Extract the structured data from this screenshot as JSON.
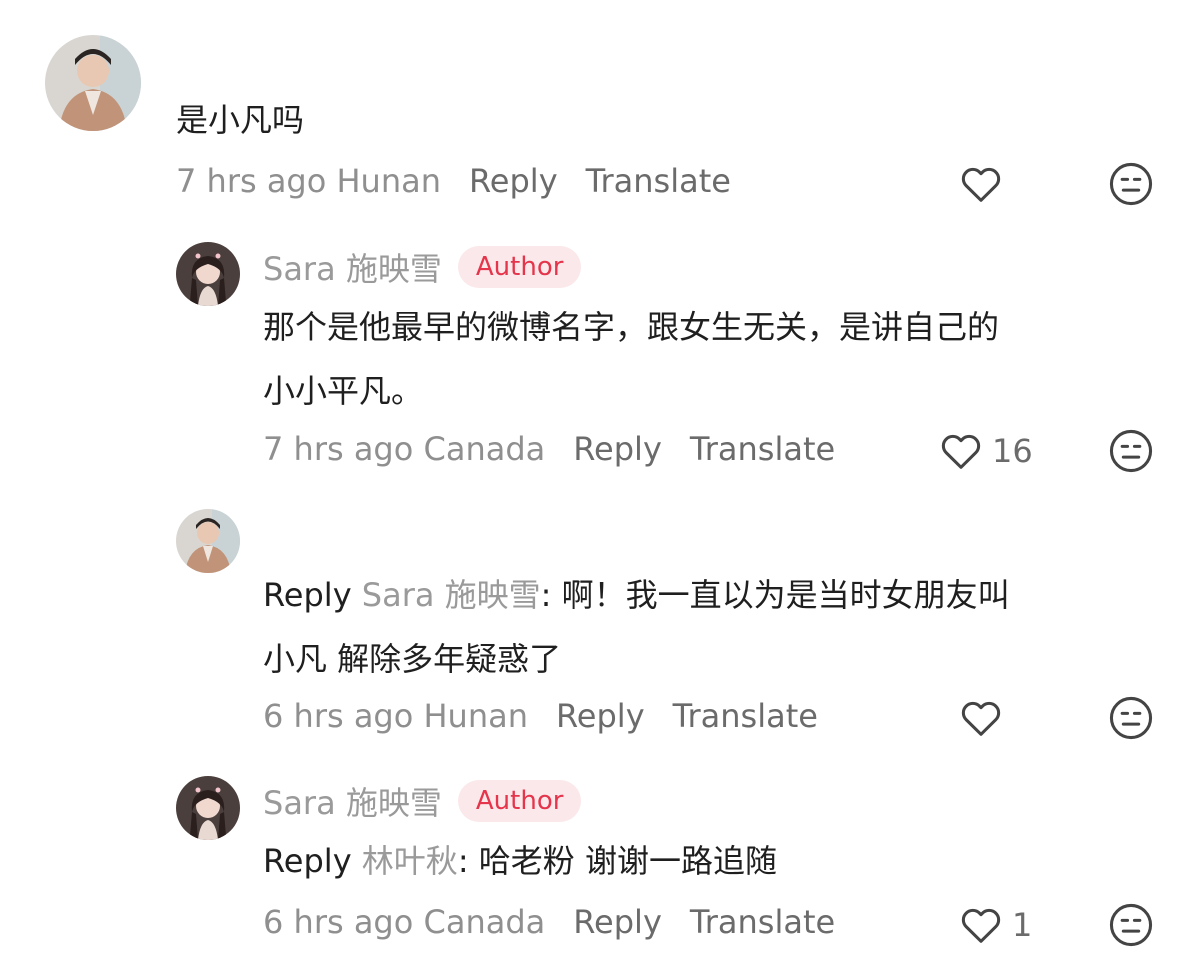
{
  "comments": [
    {
      "body": "是小凡吗",
      "meta": {
        "time": "7 hrs ago",
        "location": "Hunan",
        "reply": "Reply",
        "translate": "Translate"
      },
      "like_count": ""
    },
    {
      "name": "Sara 施映雪",
      "badge": "Author",
      "body_line1": "那个是他最早的微博名字，跟女生无关，是讲自己的",
      "body_line2": "小小平凡。",
      "meta": {
        "time": "7 hrs ago",
        "location": "Canada",
        "reply": "Reply",
        "translate": "Translate"
      },
      "like_count": "16"
    },
    {
      "reply_prefix": "Reply",
      "reply_target": "Sara 施映雪",
      "body_line1": ": 啊！我一直以为是当时女朋友叫",
      "body_line2": "小凡 解除多年疑惑了",
      "meta": {
        "time": "6 hrs ago",
        "location": "Hunan",
        "reply": "Reply",
        "translate": "Translate"
      },
      "like_count": ""
    },
    {
      "name": "Sara 施映雪",
      "badge": "Author",
      "reply_prefix": "Reply",
      "reply_target": "林叶秋",
      "body_line1": ": 哈老粉  谢谢一路追随",
      "meta": {
        "time": "6 hrs ago",
        "location": "Canada",
        "reply": "Reply",
        "translate": "Translate"
      },
      "like_count": "1"
    }
  ]
}
